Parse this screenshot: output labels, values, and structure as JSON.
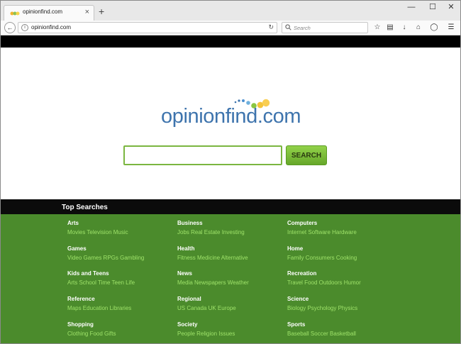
{
  "browser": {
    "tab_title": "opinionfind.com",
    "tab_close": "×",
    "new_tab": "+",
    "url": "opinionfind.com",
    "search_placeholder": "Search",
    "window_controls": {
      "minimize": "—",
      "maximize": "☐",
      "close": "✕"
    }
  },
  "page": {
    "logo_text": "opinionfind.com",
    "search_button": "SEARCH",
    "search_value": "",
    "top_searches_title": "Top Searches",
    "categories": [
      {
        "title": "Arts",
        "links": "Movies Television Music"
      },
      {
        "title": "Business",
        "links": "Jobs Real Estate Investing"
      },
      {
        "title": "Computers",
        "links": "Internet Software Hardware"
      },
      {
        "title": "Games",
        "links": "Video Games RPGs Gambling"
      },
      {
        "title": "Health",
        "links": "Fitness Medicine Alternative"
      },
      {
        "title": "Home",
        "links": "Family Consumers Cooking"
      },
      {
        "title": "Kids and Teens",
        "links": "Arts School Time Teen Life"
      },
      {
        "title": "News",
        "links": "Media Newspapers Weather"
      },
      {
        "title": "Recreation",
        "links": "Travel Food Outdoors Humor"
      },
      {
        "title": "Reference",
        "links": "Maps Education Libraries"
      },
      {
        "title": "Regional",
        "links": "US Canada UK Europe"
      },
      {
        "title": "Science",
        "links": "Biology Psychology Physics"
      },
      {
        "title": "Shopping",
        "links": "Clothing Food Gifts"
      },
      {
        "title": "Society",
        "links": "People Religion Issues"
      },
      {
        "title": "Sports",
        "links": "Baseball Soccer Basketball"
      }
    ]
  },
  "colors": {
    "logo_blue": "#3e74ad",
    "green_bar": "#4b8b2c",
    "link_green": "#9fe36a",
    "button_green": "#7bc238"
  }
}
